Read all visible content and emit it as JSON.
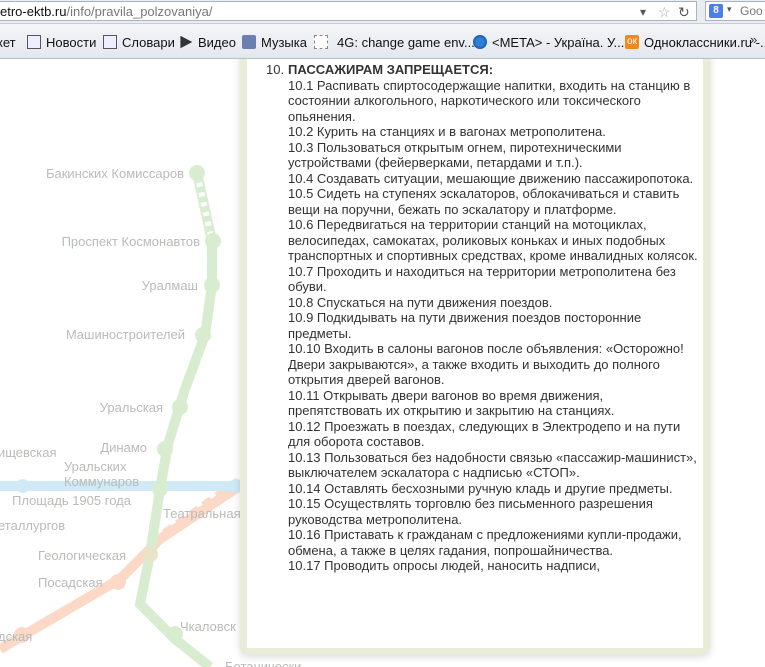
{
  "browser": {
    "url_host": "etro-ektb.ru",
    "url_path": "/info/pravila_polzovaniya/",
    "search_text": "Goo",
    "search_engine_icon": "8",
    "bookmarks": [
      {
        "label": "кет",
        "icon": "page-icon"
      },
      {
        "label": "Новости",
        "icon": "document-icon"
      },
      {
        "label": "Словари",
        "icon": "document-icon"
      },
      {
        "label": "Видео",
        "icon": "play-icon"
      },
      {
        "label": "Музыка",
        "icon": "sound-icon"
      },
      {
        "label": "4G: change game env...",
        "icon": "blank-page-icon"
      },
      {
        "label": "<META> - Україна. У...",
        "icon": "meta-flower-icon"
      },
      {
        "label": "Одноклассники.ru -...",
        "icon": "odnoklassniki-icon"
      }
    ],
    "more_label": "»"
  },
  "map": {
    "stations": [
      "Бакинских Комиссаров",
      "Проспект Космонавтов",
      "Уралмаш",
      "Машиностроителей",
      "Уральская",
      "Динамо",
      "Уральских",
      "Коммунаров",
      "ищевская",
      "Площадь 1905 года",
      "еталлургов",
      "Театральная",
      "Геологическая",
      "Посадская",
      "дская",
      "Чкаловск",
      "Ботанически"
    ],
    "line_colors": {
      "green": "#d8edd0",
      "orange": "#fbd9c6",
      "blue": "#cfeaf6"
    }
  },
  "rules": {
    "number": "10.",
    "heading": "ПАССАЖИРАМ ЗАПРЕЩАЕТСЯ:",
    "items": [
      "10.1 Распивать спиртосодержащие напитки, входить на станцию в состоянии алкогольного, наркотического или токсического опьянения.",
      "10.2 Курить на станциях и в вагонах метрополитена.",
      "10.3 Пользоваться открытым огнем, пиротехническими устройствами (фейерверками, петардами и т.п.).",
      "10.4 Создавать ситуации, мешающие движению пассажиропотока.",
      "10.5 Сидеть на ступенях эскалаторов, облокачиваться и ставить вещи на поручни, бежать по эскалатору и платформе.",
      "10.6 Передвигаться на территории станций на мотоциклах, велосипедах, самокатах, роликовых коньках и иных подобных транспортных и спортивных средствах, кроме инвалидных колясок.",
      "10.7 Проходить и находиться на территории метрополитена без обуви.",
      "10.8 Спускаться на пути движения поездов.",
      "10.9 Подкидывать на пути движения поездов посторонние предметы.",
      "10.10 Входить в салоны вагонов после объявления: «Осторожно! Двери закрываются», а также входить и выходить до полного открытия дверей вагонов.",
      "10.11 Открывать двери вагонов во время движения, препятствовать их открытию и закрытию на станциях.",
      "10.12 Проезжать в поездах, следующих в Электродепо и на пути для оборота составов.",
      "10.13 Пользоваться без надобности связью «пассажир-машинист», выключателем эскалатора с надписью «СТОП».",
      "10.14 Оставлять бесхозными ручную кладь и другие предметы.",
      "10.15 Осуществлять торговлю без письменного разрешения руководства метрополитена.",
      "10.16 Приставать к гражданам с предложениями купли-продажи, обмена, а также в целях гадания, попрошайничества.",
      "10.17 Проводить опросы людей, наносить надписи,"
    ]
  }
}
